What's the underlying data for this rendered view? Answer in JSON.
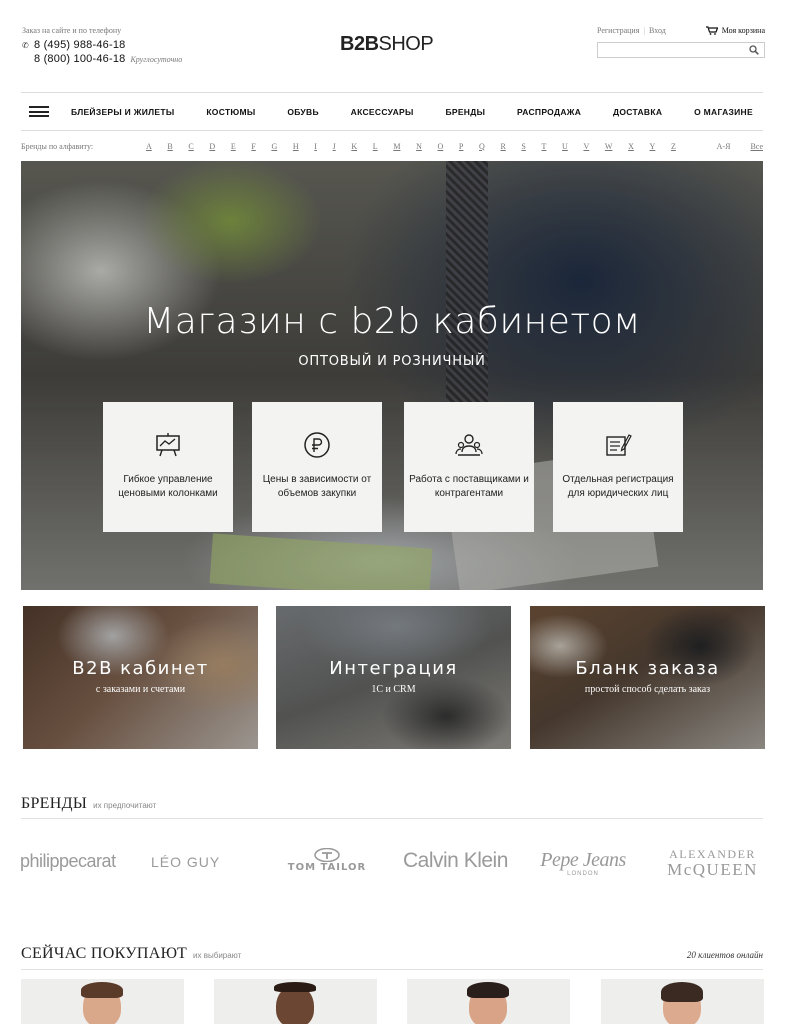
{
  "header": {
    "order_caption": "Заказ на сайте и по телефону",
    "phone1": "8 (495) 988-46-18",
    "phone2": "8 (800) 100-46-18",
    "phone_note": "Круглосуточно",
    "logo_bold": "B2B",
    "logo_rest": "SHOP",
    "register": "Регистрация",
    "login": "Вход",
    "cart": "Моя корзина",
    "search_placeholder": ""
  },
  "nav": {
    "items": [
      "БЛЕЙЗЕРЫ И ЖИЛЕТЫ",
      "КОСТЮМЫ",
      "ОБУВЬ",
      "АКСЕССУАРЫ",
      "БРЕНДЫ",
      "РАСПРОДАЖА",
      "ДОСТАВКА",
      "О МАГАЗИНЕ"
    ]
  },
  "alphabet": {
    "label": "Бренды по алфавиту:",
    "letters": [
      "A",
      "B",
      "C",
      "D",
      "E",
      "F",
      "G",
      "H",
      "I",
      "J",
      "K",
      "L",
      "M",
      "N",
      "O",
      "P",
      "Q",
      "R",
      "S",
      "T",
      "U",
      "V",
      "W",
      "X",
      "Y",
      "Z"
    ],
    "cyrillic": "А-Я",
    "all": "Все"
  },
  "hero": {
    "title": "Магазин с b2b кабинетом",
    "subtitle": "ОПТОВЫЙ И РОЗНИЧНЫЙ",
    "features": [
      {
        "icon": "chart-board-icon",
        "text": "Гибкое управление ценовыми колонками"
      },
      {
        "icon": "ruble-icon",
        "text": "Цены в зависимости от объемов закупки"
      },
      {
        "icon": "people-icon",
        "text": "Работа с поставщиками и контрагентами"
      },
      {
        "icon": "form-pen-icon",
        "text": "Отдельная регистрация для юридических лиц"
      }
    ]
  },
  "tiles": [
    {
      "title": "B2B кабинет",
      "subtitle": "с заказами и счетами"
    },
    {
      "title": "Интеграция",
      "subtitle": "1С и CRM"
    },
    {
      "title": "Бланк заказа",
      "subtitle": "простой способ сделать заказ"
    }
  ],
  "brands_section": {
    "title": "БРЕНДЫ",
    "hint": "их предпочитают",
    "brands": [
      "philippecarat",
      "LÉO GUY",
      "TOM TAILOR",
      "Calvin Klein",
      "Pepe Jeans",
      "LONDON",
      "ALEXANDER",
      "McQUEEN"
    ]
  },
  "buying_section": {
    "title": "СЕЙЧАС ПОКУПАЮТ",
    "hint": "их выбирают",
    "online": "20 клиентов онлайн"
  },
  "colors": {
    "text": "#222222",
    "muted": "#777777",
    "border": "#dddddd",
    "tile_bg": "#f3f3f1"
  }
}
